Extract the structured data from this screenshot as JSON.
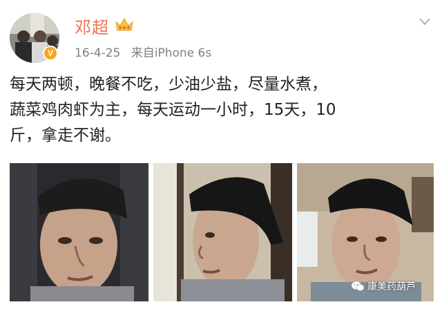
{
  "post": {
    "username": "邓超",
    "date": "16-4-25",
    "source": "来自iPhone 6s",
    "text": "每天两顿，晚餐不吃，少油少盐，尽量水煮，\n蔬菜鸡肉虾为主，每天运动一小时，15天，10\n斤，拿走不谢。",
    "verified_badge": "V",
    "icons": {
      "vip": "vip-crown-icon",
      "menu": "chevron-down-icon",
      "watermark": "wechat-icon"
    }
  },
  "watermark": {
    "label": "康美药葫芦"
  },
  "colors": {
    "username": "#eb7350",
    "meta": "#808080",
    "text": "#222222",
    "badge": "#f5a623"
  }
}
